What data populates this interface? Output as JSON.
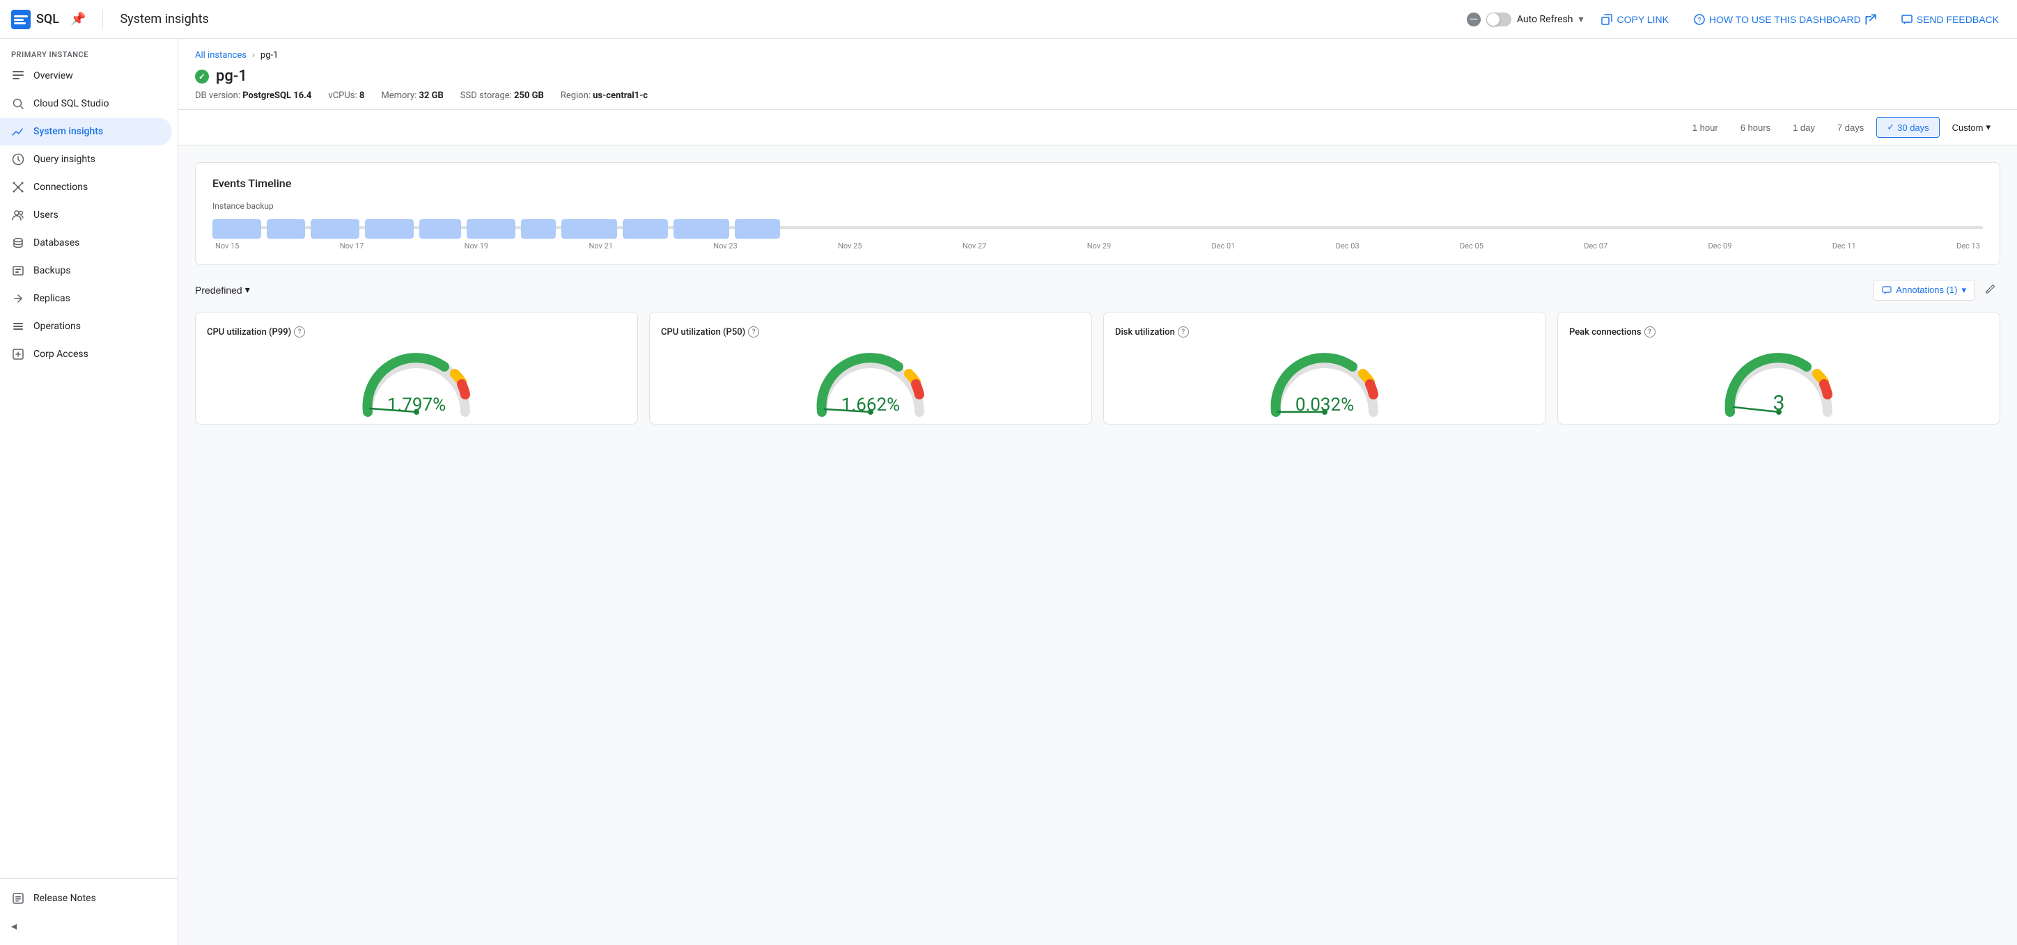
{
  "topbar": {
    "logo_text": "SQL",
    "title": "System insights",
    "auto_refresh_label": "Auto Refresh",
    "copy_link_label": "COPY LINK",
    "how_to_use_label": "HOW TO USE THIS DASHBOARD",
    "send_feedback_label": "SEND FEEDBACK"
  },
  "sidebar": {
    "section_label": "Primary instance",
    "items": [
      {
        "id": "overview",
        "label": "Overview",
        "icon": "list-icon"
      },
      {
        "id": "cloud-sql-studio",
        "label": "Cloud SQL Studio",
        "icon": "search-icon"
      },
      {
        "id": "system-insights",
        "label": "System insights",
        "icon": "chart-icon",
        "active": true
      },
      {
        "id": "query-insights",
        "label": "Query insights",
        "icon": "insights-icon"
      },
      {
        "id": "connections",
        "label": "Connections",
        "icon": "connections-icon"
      },
      {
        "id": "users",
        "label": "Users",
        "icon": "users-icon"
      },
      {
        "id": "databases",
        "label": "Databases",
        "icon": "databases-icon"
      },
      {
        "id": "backups",
        "label": "Backups",
        "icon": "backups-icon"
      },
      {
        "id": "replicas",
        "label": "Replicas",
        "icon": "replicas-icon"
      },
      {
        "id": "operations",
        "label": "Operations",
        "icon": "operations-icon"
      },
      {
        "id": "corp-access",
        "label": "Corp Access",
        "icon": "corp-icon"
      }
    ],
    "release_notes_label": "Release Notes",
    "collapse_label": "Collapse"
  },
  "breadcrumb": {
    "all_instances": "All instances",
    "current": "pg-1"
  },
  "instance": {
    "name": "pg-1",
    "db_version_label": "DB version:",
    "db_version_value": "PostgreSQL 16.4",
    "vcpus_label": "vCPUs:",
    "vcpus_value": "8",
    "memory_label": "Memory:",
    "memory_value": "32 GB",
    "storage_label": "SSD storage:",
    "storage_value": "250 GB",
    "region_label": "Region:",
    "region_value": "us-central1-c"
  },
  "time_range": {
    "options": [
      "1 hour",
      "6 hours",
      "1 day",
      "7 days",
      "30 days",
      "Custom"
    ],
    "active": "30 days"
  },
  "events_timeline": {
    "title": "Events Timeline",
    "label": "Instance backup",
    "axis_labels": [
      "Nov 15",
      "Nov 17",
      "Nov 19",
      "Nov 21",
      "Nov 23",
      "Nov 25",
      "Nov 27",
      "Nov 29",
      "Dec 01",
      "Dec 03",
      "Dec 05",
      "Dec 07",
      "Dec 09",
      "Dec 11",
      "Dec 13"
    ],
    "bars": [
      1,
      1,
      1,
      1,
      1,
      1,
      1,
      1,
      1,
      1,
      1
    ]
  },
  "predefined": {
    "label": "Predefined",
    "annotations_label": "Annotations (1)",
    "gauges": [
      {
        "id": "cpu-p99",
        "title": "CPU utilization (P99)",
        "value": "1.797%",
        "color": "#188038"
      },
      {
        "id": "cpu-p50",
        "title": "CPU utilization (P50)",
        "value": "1.662%",
        "color": "#188038"
      },
      {
        "id": "disk",
        "title": "Disk utilization",
        "value": "0.032%",
        "color": "#188038"
      },
      {
        "id": "peak-connections",
        "title": "Peak connections",
        "value": "3",
        "color": "#188038"
      }
    ]
  },
  "icons": {
    "checkmark": "✓",
    "pin": "📌",
    "chevron_down": "▾",
    "chevron_right": "›",
    "pencil": "✏",
    "collapse": "◂"
  }
}
